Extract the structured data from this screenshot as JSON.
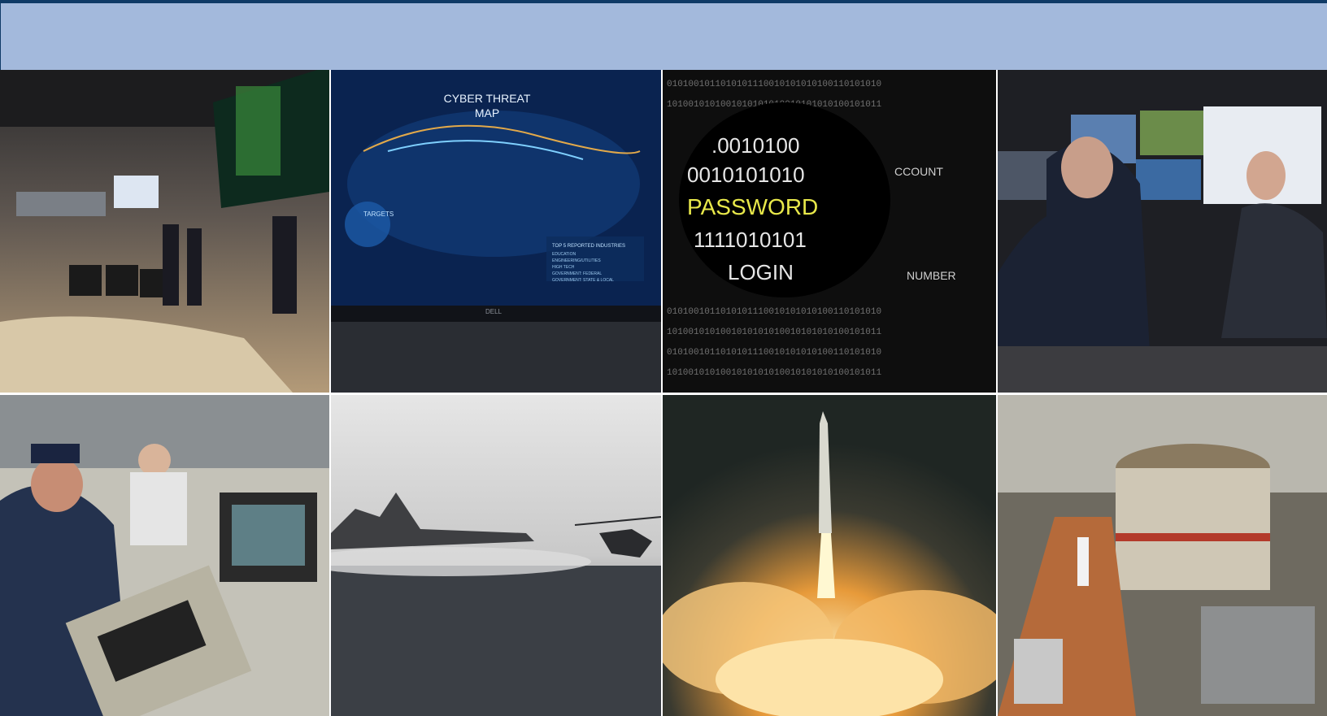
{
  "colors": {
    "banner": "#a3b9dc",
    "banner_border": "#0f3a66"
  },
  "tiles": {
    "ops_center": {
      "label": "operations-center-photo"
    },
    "cyber_map": {
      "title_line1": "CYBER THREAT",
      "title_line2": "MAP",
      "targets": "TARGETS",
      "top5": "TOP 5 REPORTED INDUSTRIES",
      "industries": [
        "EDUCATION",
        "ENGINEERING/UTILITIES",
        "HIGH TECH",
        "GOVERNMENT: FEDERAL",
        "GOVERNMENT: STATE & LOCAL"
      ],
      "brand": "DELL"
    },
    "binary": {
      "row1": ".0010100",
      "row2": "0010101010",
      "row3": "PASSWORD",
      "row4": "1111010101",
      "row5": "LOGIN",
      "side1": "CCOUNT",
      "side2": "NUMBER"
    },
    "control_room": {
      "label": "control-room-officials-photo"
    },
    "ship_console": {
      "label": "ship-console-press-photo"
    },
    "carrier_sea": {
      "label": "aircraft-carrier-sea-photo"
    },
    "missile_launch": {
      "label": "missile-launch-photo"
    },
    "reactor_hall": {
      "label": "reactor-hall-photo"
    }
  }
}
